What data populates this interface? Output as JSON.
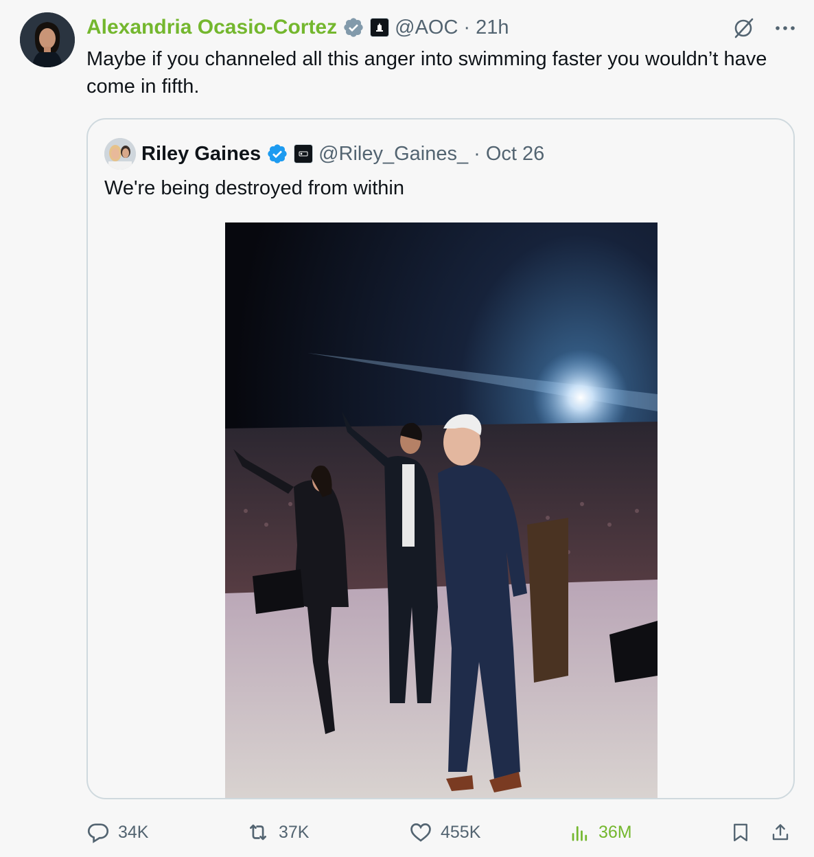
{
  "tweet": {
    "author_name": "Alexandria Ocasio-Cortez",
    "handle": "@AOC",
    "separator": "·",
    "time": "21h",
    "text": "Maybe if you channeled all this anger into swimming faster you wouldn’t have come in fifth."
  },
  "quoted": {
    "author_name": "Riley Gaines",
    "handle": "@Riley_Gaines_",
    "separator": "·",
    "date": "Oct 26",
    "text": "We're being destroyed from within"
  },
  "actions": {
    "replies": "34K",
    "reposts": "37K",
    "likes": "455K",
    "views": "36M"
  },
  "colors": {
    "author_name": "#74b72e",
    "views": "#74b72e",
    "verified_gray": "#829aab",
    "verified_blue": "#1d9bf0"
  },
  "icons": [
    "verified-gray-icon",
    "government-affiliate-icon",
    "verified-blue-icon",
    "org-affiliate-icon",
    "grok-icon",
    "more-icon",
    "reply-icon",
    "repost-icon",
    "like-icon",
    "views-icon",
    "bookmark-icon",
    "share-icon"
  ]
}
